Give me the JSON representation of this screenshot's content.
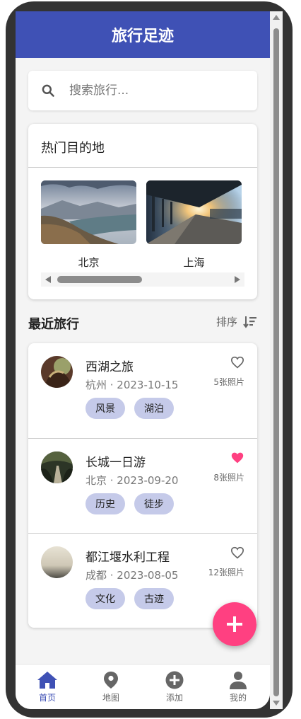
{
  "app": {
    "title": "旅行足迹"
  },
  "search": {
    "placeholder": "搜索旅行..."
  },
  "destinations": {
    "title": "热门目的地",
    "items": [
      {
        "label": "北京"
      },
      {
        "label": "上海"
      }
    ]
  },
  "recent": {
    "title": "最近旅行",
    "sort_label": "排序",
    "trips": [
      {
        "name": "西湖之旅",
        "meta": "杭州 · 2023-10-15",
        "tags": [
          "风景",
          "湖泊"
        ],
        "photos": "5张照片",
        "favorite": false
      },
      {
        "name": "长城一日游",
        "meta": "北京 · 2023-09-20",
        "tags": [
          "历史",
          "徒步"
        ],
        "photos": "8张照片",
        "favorite": true
      },
      {
        "name": "都江堰水利工程",
        "meta": "成都 · 2023-08-05",
        "tags": [
          "文化",
          "古迹"
        ],
        "photos": "12张照片",
        "favorite": false
      }
    ]
  },
  "nav": {
    "items": [
      {
        "label": "首页",
        "icon": "home-icon",
        "active": true
      },
      {
        "label": "地图",
        "icon": "map-pin-icon",
        "active": false
      },
      {
        "label": "添加",
        "icon": "add-circle-icon",
        "active": false
      },
      {
        "label": "我的",
        "icon": "person-icon",
        "active": false
      }
    ]
  },
  "colors": {
    "primary": "#3f51b5",
    "accent": "#ff4081",
    "tag_bg": "#c5cae9"
  }
}
